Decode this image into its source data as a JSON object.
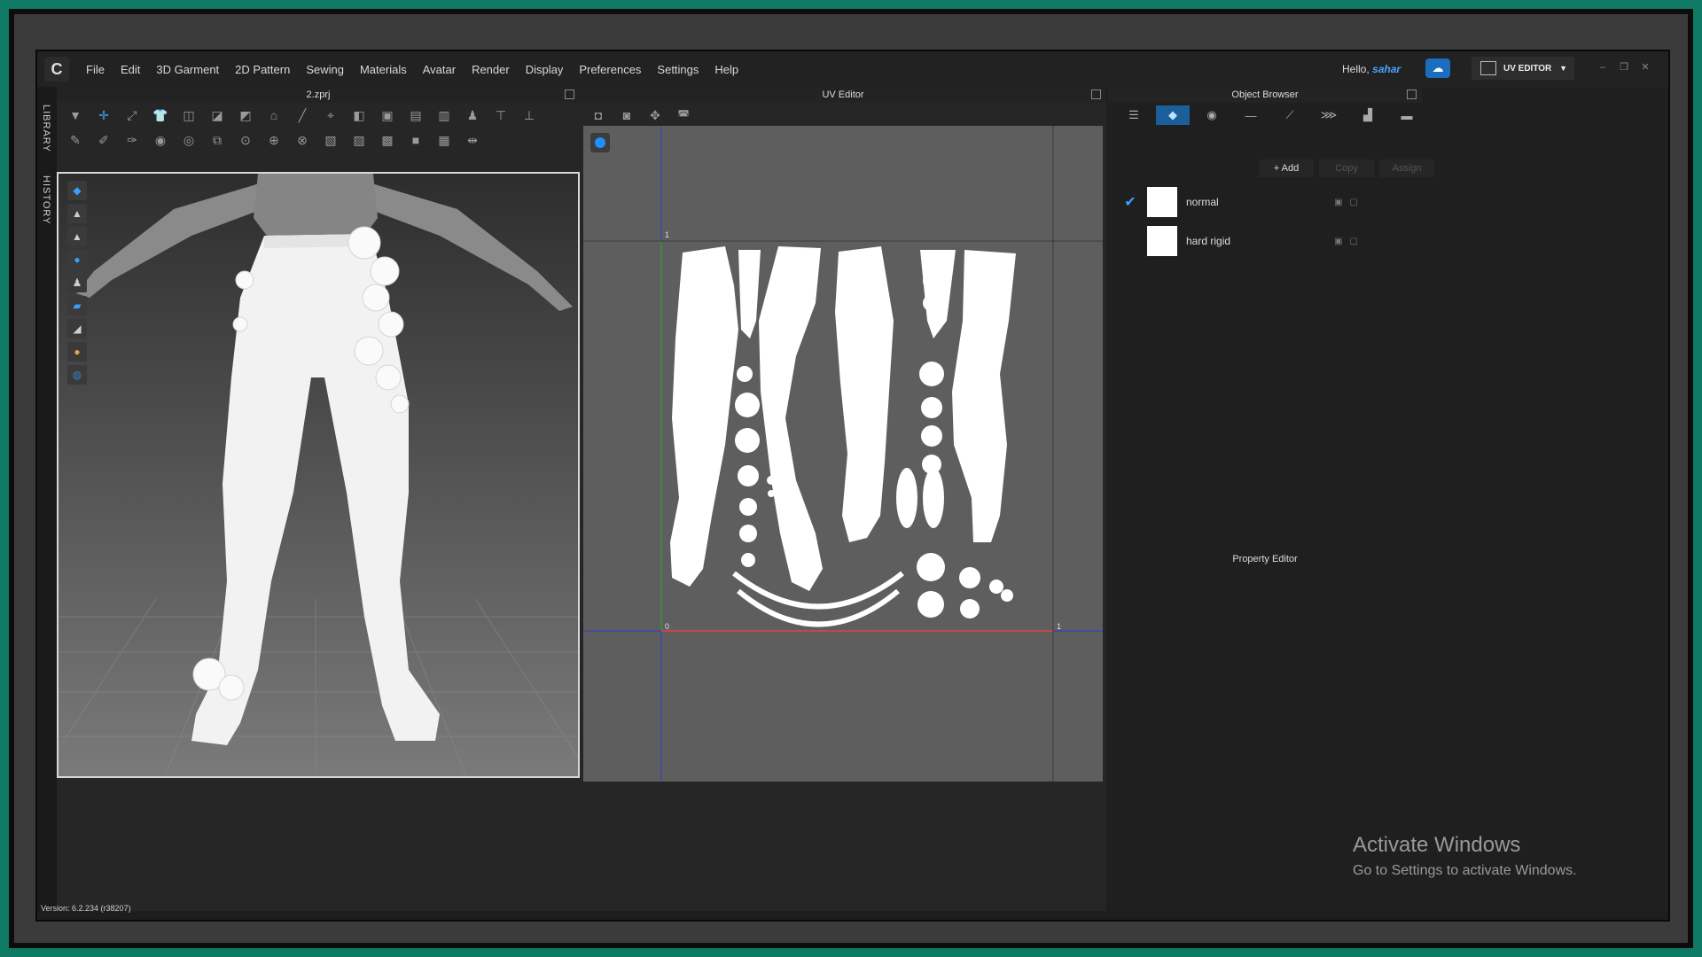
{
  "menu": [
    "File",
    "Edit",
    "3D Garment",
    "2D Pattern",
    "Sewing",
    "Materials",
    "Avatar",
    "Render",
    "Display",
    "Preferences",
    "Settings",
    "Help"
  ],
  "user": {
    "greeting": "Hello,",
    "name": "sahar"
  },
  "mode": {
    "label": "UV EDITOR"
  },
  "left_tabs": {
    "library": "LIBRARY",
    "history": "HISTORY"
  },
  "panel3d": {
    "title": "2.zprj"
  },
  "uv": {
    "title": "UV Editor",
    "tick_1": "1",
    "tick_0": "0",
    "tick_1b": "1"
  },
  "object_browser": {
    "title": "Object Browser",
    "add": "+ Add",
    "copy": "Copy",
    "assign": "Assign",
    "materials": [
      {
        "name": "normal",
        "checked": true
      },
      {
        "name": "hard rigid",
        "checked": false
      }
    ]
  },
  "property_editor": {
    "title": "Property Editor"
  },
  "version": "Version: 6.2.234 (r38207)",
  "watermark": {
    "line1": "Activate Windows",
    "line2": "Go to Settings to activate Windows."
  },
  "colors": {
    "frame": "#0f7a63",
    "accent": "#3aa0ff",
    "axis_x": "#ff3b3b",
    "axis_y": "#2ea82e"
  }
}
